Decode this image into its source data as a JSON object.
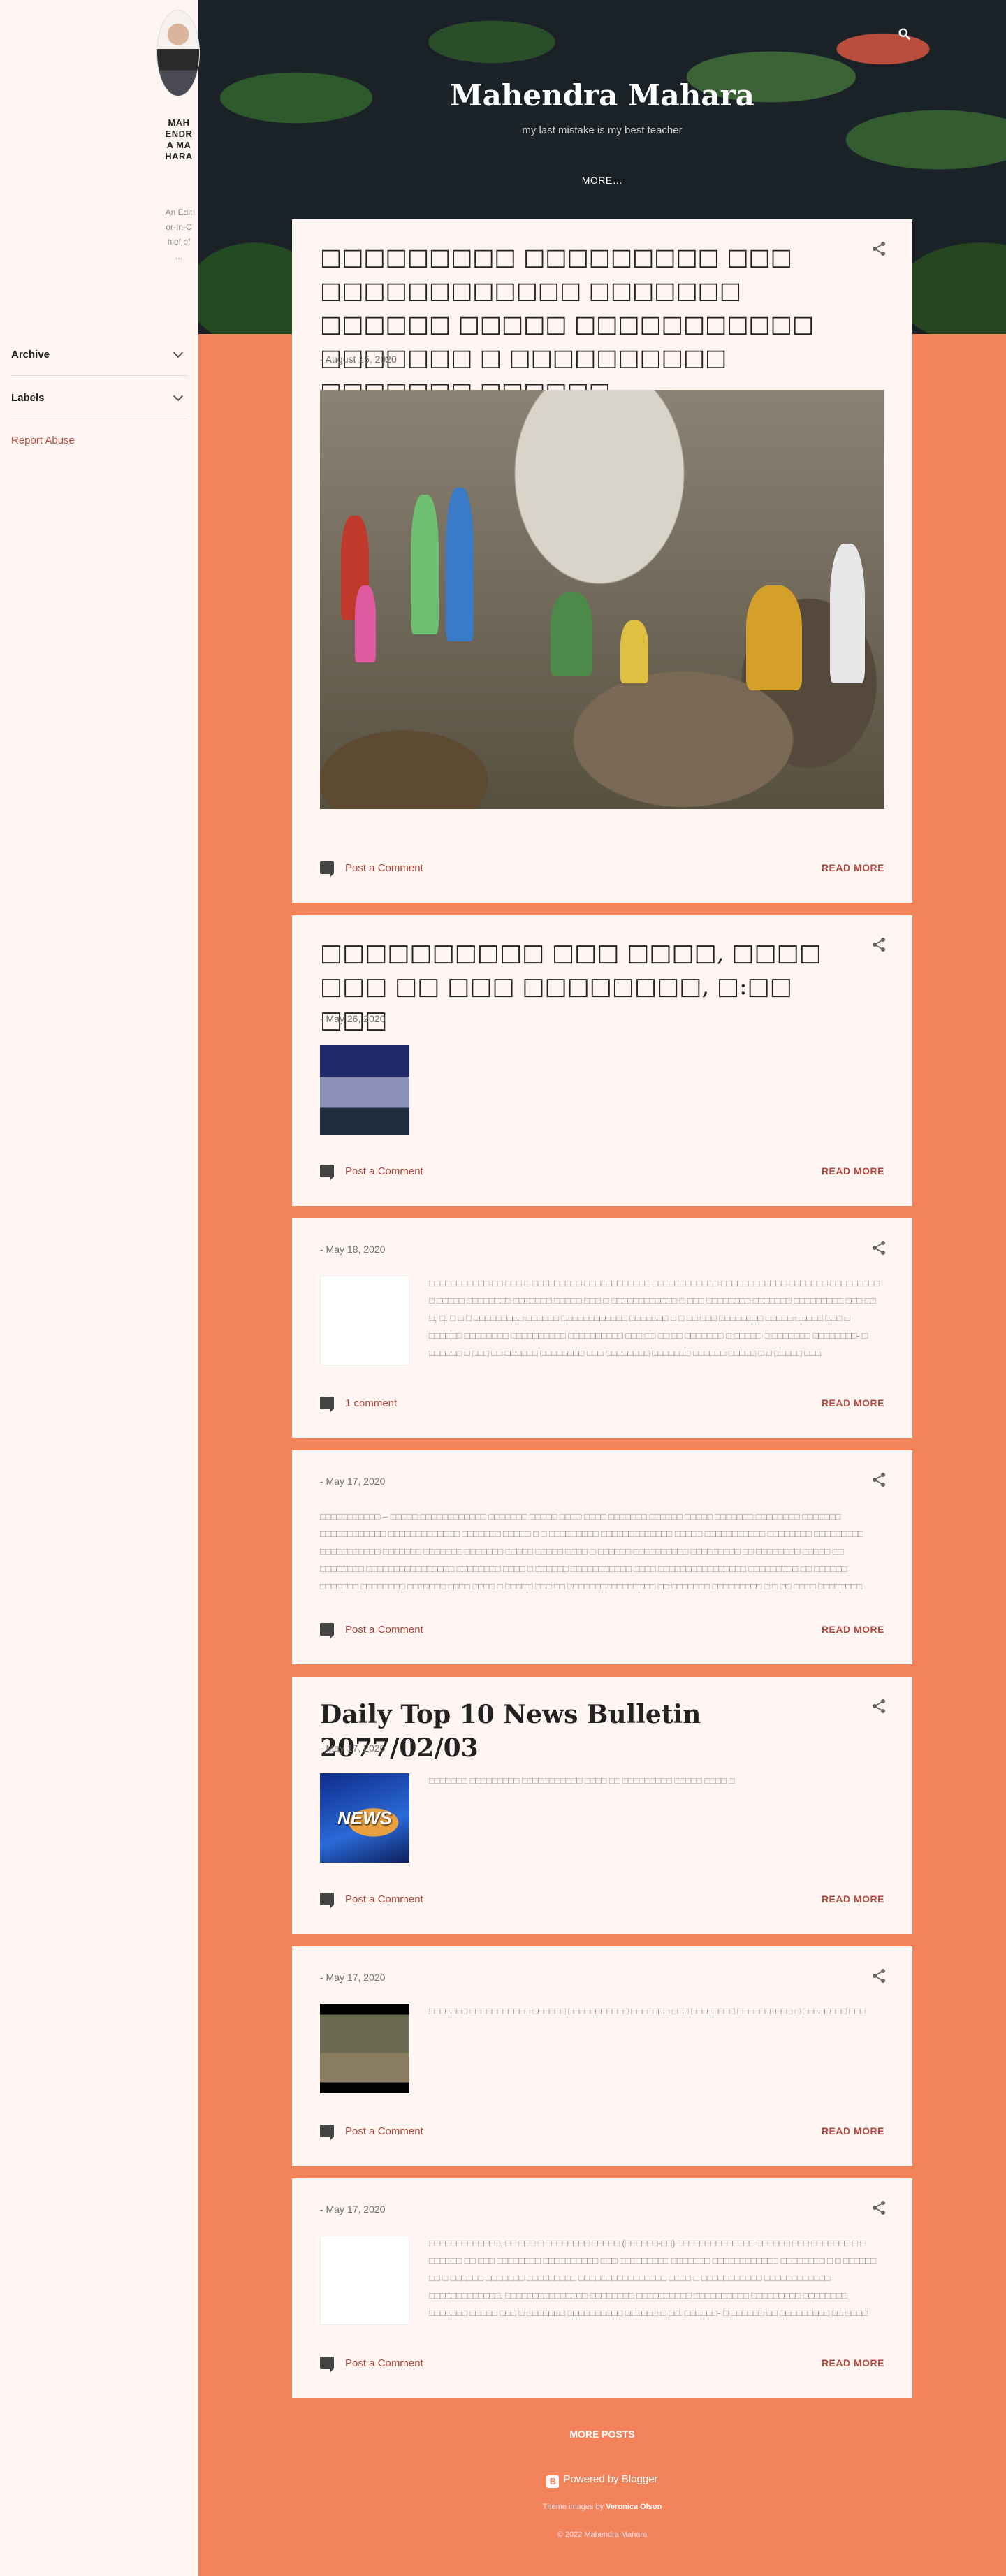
{
  "sidebar": {
    "profile_name": "MAHENDRA MAHARA",
    "profile_desc": "An Editor-In-Chief of ...",
    "archive_label": "Archive",
    "labels_label": "Labels",
    "report_abuse": "Report Abuse"
  },
  "header": {
    "title": "Mahendra Mahara",
    "description": "my last mistake is my best teacher",
    "more": "MORE…"
  },
  "posts": [
    {
      "title": "□□□□□□□□□ □□□□□□□□□ □□□ □□□□□□□□□□□□ □□□□□□□ □□□□□□ □□□□□ □□□□□□□□□□□ □□□□□□□ □ □□□□□□□□□□ □□□□□□□ □□□□□□",
      "date": "- August 15, 2020",
      "comments": "Post a Comment",
      "read_more": "READ MORE"
    },
    {
      "title": "□□□□□□□□□□ □□□ □□□□, □□□□ □□□ □□ □□□ □□□□□□□□, □:□□ □□□",
      "date": "- May 26, 2020",
      "comments": "Post a Comment",
      "read_more": "READ MORE"
    },
    {
      "date": "- May 18, 2020",
      "snippet": "□□□□□□□□□□□.□□ □□□ □ □□□□□□□□□ □□□□□□□□□□□□ □□□□□□□□□□□□ □□□□□□□□□□□□ □□□□□□□ □□□□□□□□□ □ □□□□□ □□□□□□□□ □□□□□□□ □□□□□ □□□ □ □□□□□□□□□□□□ □ □□□ □□□□□□□□ □□□□□□□ □□□□□□□□□ □□□ □□ □, □, □ □ □ □□□□□□□□□ □□□□□□ □□□□□□□□□□□□ □□□□□□□ □ □ □□ □□□ □□□□□□□□ □□□□□ □□□□□ □□□ □ □□□□□□ □□□□□□□□ □□□□□□□□□□ □□□□□□□□□□ □□□ □□ □□ □□ □□□□□□□ □ □□□□□ □ □□□□□□□ □□□□□□□□- □ □□□□□□ □ □□□ □□ □□□□□□ □□□□□□□□ □□□ □□□□□□□□ □□□□□□□ □□□□□□ □□□□□ □ □ □□□□□ □□□ □□□□□□□□□□□□□□□□□□□ □□□□□□□□□□ □□□□□□□ □ □□□□□□□□□□ □□□□□ …",
      "comments": "1 comment",
      "read_more": "READ MORE"
    },
    {
      "date": "- May 17, 2020",
      "snippet": "□□□□□□□□□□□ – □□□□□ □□□□□□□□□□□□ □□□□□□□ □□□□□ □□□□ □□□□ □□□□□□□ □□□□□□ □□□□□ □□□□□□□ □□□□□□□□ □□□□□□□ □□□□□□□□□□□□ □□□□□□□□□□□□□ □□□□□□□ □□□□□ □ □ □□□□□□□□□ □□□□□□□□□□□□□ □□□□□ □□□□□□□□□□□ □□□□□□□□ □□□□□□□□□ □□□□□□□□□□□ □□□□□□□ □□□□□□□ □□□□□□□ □□□□□ □□□□□ □□□□ □ □□□□□□ □□□□□□□□□□ □□□□□□□□□ □□ □□□□□□□□ □□□□□ □□ □□□□□□□□ □□□□□□□□□□□□□□□□ □□□□□□□□ □□□□ □ □□□□□□ □□□□□□□□□□□ □□□□ □□□□□□□□□□□□□□□□ □□□□□□□□□ □□ □□□□□□ □□□□□□□ □□□□□□□□ □□□□□□□ □□□□ □□□□ □ □□□□□ □□□ □□ □□□□□□□□□□□□□□□□ □□ □□□□□□□ □□□□□□□□□ □ □ □□ □□□□ □□□□□□□□ □□□□□□□ □□□□□ □□□□□□□□□ □□□□ □□□□ □□□□□□□ □□□□□ □□ □□□□□□ □ □",
      "comments": "Post a Comment",
      "read_more": "READ MORE"
    },
    {
      "title": "Daily Top 10 News Bulletin 2077/02/03",
      "date": "- May 17, 2020",
      "snippet": "□□□□□□□ □□□□□□□□□ □□□□□□□□□□□ □□□□ □□ □□□□□□□□□ □□□□□ □□□□ □",
      "thumb_text": "NEWS",
      "comments": "Post a Comment",
      "read_more": "READ MORE"
    },
    {
      "date": "- May 17, 2020",
      "snippet": "□□□□□□□ □□□□□□□□□□□ □□□□□□ □□□□□□□□□□□ □□□□□□□ □□□  □□□□□□□□ □□□□□□□□□□ □ □□□□□□□□ □□□ □□□□□□□□",
      "comments": "Post a Comment",
      "read_more": "READ MORE"
    },
    {
      "date": "- May 17, 2020",
      "snippet": "□□□□□□□□□□□□□, □□ □□□ □ □□□□□□□□ □□□□□ (□□□□□□-□□) □□□□□□□□□□□□□□ □□□□□□ □□□ □□□□□□□ □ □ □□□□□□ □□ □□□ □□□□□□□□ □□□□□□□□□□ □□□ □□□□□□□□□ □□□□□□□ □□□□□□□□□□□□ □□□□□□□□ □ □ □□□□□□ □□ □ □□□□□□ □□□□□□□ □□□□□□□□□ □□□□□□□□□□□□□□□□ □□□□ □ □□□□□□□□□□□ □□□□□□□□□□□□ □□□□□□□□□□□□□. □□□□□□□□□□□□□□□ □□□□□□□□ □□□□□□□□□□ □□□□□□□□□□ □□□□□□□□□ □□□□□□□□ □□□□□□□ □□□□□ □□□ □ □□□□□□□ □□□□□□□□□□ □□□□□□ □ □□. □□□□□□- □ □□□□□□ □□ □□□□□□□□□ □□ □□□□ □□□□ □□□□□□ □ □□□ □□□□□ □□□ □ □□□□□□□ □□□□□□□□□ □□□□□□ □ □□.- □ □□□□□□ □□, □□ □",
      "comments": "Post a Comment",
      "read_more": "READ MORE"
    }
  ],
  "footer": {
    "more_posts": "MORE POSTS",
    "powered_by": "Powered by Blogger",
    "theme_prefix": "Theme images by",
    "theme_author": "Veronica Olson",
    "copyright": "© 2022 Mahendra Mahara"
  },
  "colors": {
    "accent": "#f2835a",
    "link": "#b5483c",
    "card": "#fff5f3"
  }
}
